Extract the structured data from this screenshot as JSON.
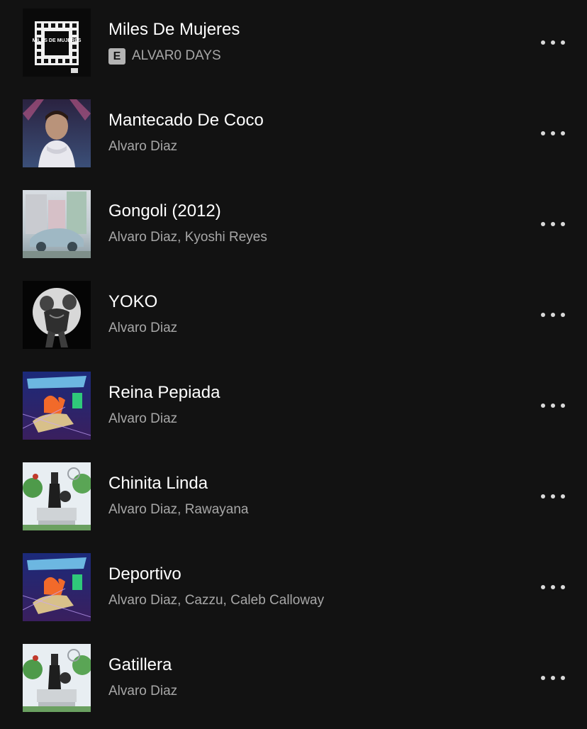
{
  "tracks": [
    {
      "title": "Miles De Mujeres",
      "explicit_badge": "E",
      "artists": "ALVAR0 DAYS",
      "cover_art": "miles-de-mujeres-cover",
      "cover_text": "MILES DE MUJERES"
    },
    {
      "title": "Mantecado De Coco",
      "artists": "Alvaro Diaz",
      "cover_art": "mantecado-de-coco-cover"
    },
    {
      "title": "Gongoli (2012)",
      "artists": "Alvaro Diaz, Kyoshi Reyes",
      "cover_art": "gongoli-cover"
    },
    {
      "title": "YOKO",
      "artists": "Alvaro Diaz",
      "cover_art": "yoko-cover"
    },
    {
      "title": "Reina Pepiada",
      "artists": "Alvaro Diaz",
      "cover_art": "diazantes-cover"
    },
    {
      "title": "Chinita Linda",
      "artists": "Alvaro Diaz, Rawayana",
      "cover_art": "statue-park-cover"
    },
    {
      "title": "Deportivo",
      "artists": "Alvaro Diaz, Cazzu, Caleb Calloway",
      "cover_art": "diazantes-cover"
    },
    {
      "title": "Gatillera",
      "artists": "Alvaro Diaz",
      "cover_art": "statue-park-cover"
    }
  ],
  "icons": {
    "more_options": "more-options-icon"
  },
  "colors": {
    "background": "#121212",
    "title_text": "#ffffff",
    "subtitle_text": "#a7a7a7",
    "explicit_badge_bg": "#b3b3b3"
  }
}
